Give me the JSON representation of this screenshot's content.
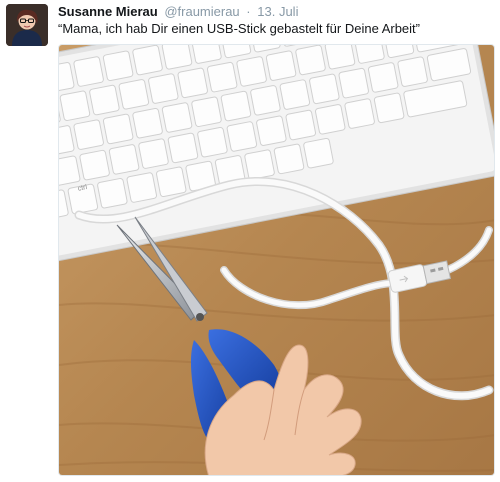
{
  "tweet": {
    "author_name": "Susanne Mierau",
    "handle": "@fraumierau",
    "separator": "·",
    "date": "13. Juli",
    "text": "“Mama, ich hab Dir einen USB-Stick gebastelt für Deine Arbeit”"
  },
  "media": {
    "description_icon": "photo-icon",
    "colors": {
      "wood": "#b98a55",
      "keyboard": "#f3f3f3",
      "cable": "#f7f7f7",
      "scissor_handle": "#1f4fb8"
    }
  }
}
